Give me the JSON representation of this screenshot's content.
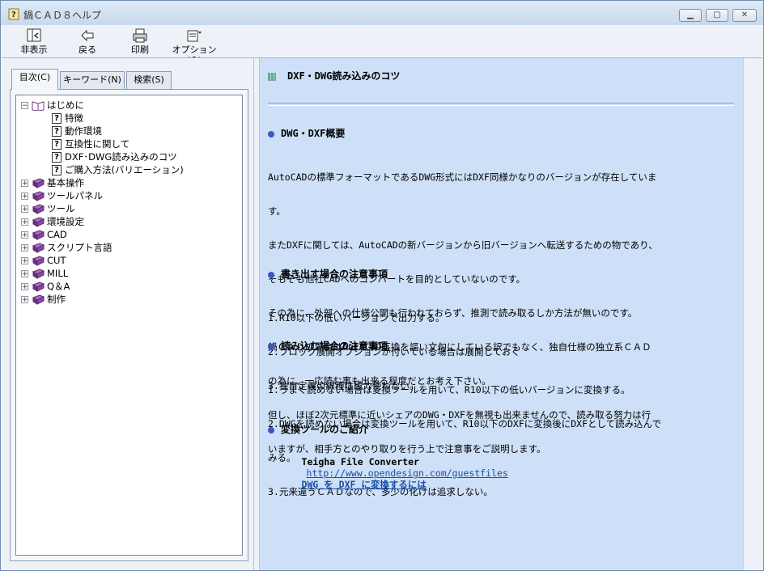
{
  "window": {
    "title": "鍋ＣＡＤ８ヘルプ"
  },
  "toolbar": {
    "hide": "非表示",
    "back": "戻る",
    "print": "印刷",
    "options": "オプション(O)"
  },
  "tabs": [
    "目次(C)",
    "キーワード(N)",
    "検索(S)"
  ],
  "tree": {
    "root": "はじめに",
    "children": [
      "特徴",
      "動作環境",
      "互換性に関して",
      "DXF･DWG読み込みのコツ",
      "ご購入方法(バリエーション)"
    ],
    "books": [
      "基本操作",
      "ツールパネル",
      "ツール",
      "環境設定",
      "CAD",
      "スクリプト言語",
      "CUT",
      "MILL",
      "Q＆A",
      "制作"
    ]
  },
  "doc": {
    "title": "DXF・DWG読み込みのコツ",
    "s1": {
      "heading": "DWG・DXF概要",
      "lines": [
        "AutoCADの標準フォーマットであるDWG形式にはDXF同様かなりのバージョンが存在していま",
        "す。",
        "またDXFに関しては、AutoCADの新バージョンから旧バージョンへ転送するための物であり、",
        "そもそも他社CADへのコンバートを目的としていないのです。",
        "その為に、外部への仕様公開も行われておらず、推測で読み取るしか方法が無いのです。",
        "鍋ＣＡＤの場合はAutoCAD互換を謳い文句にしている訳でもなく、独自仕様の独立系ＣＡＤ",
        "の為に、一応読む事も出来る程度だとお考え下さい。",
        "但し、ほぼ2次元標準に近いシェアのDWG・DXFを無視も出来ませんので、読み取る努力は行",
        "いますが、相手方とのやり取りを行う上で注意事をご説明します。"
      ]
    },
    "s2": {
      "heading": "書き出す場合の注意事項",
      "lines": [
        "1.R10以下の低いバージョンで出力する。",
        "2.ブロック展開オプションが付いている場合は展開しておく",
        "3.独自定義の線種は極力使わない。"
      ]
    },
    "s3": {
      "heading": "読み込む場合の注意事項",
      "lines": [
        "1.うまく読めない場合は変換ツールを用いて、R10以下の低いバージョンに変換する。",
        "2.DWGを読めない場合は変換ツールを用いて、R10以下のDXFに変換後にDXFとして読み込んで",
        "みる。",
        "3.元来違うＣＡＤなので、多少の化けは追求しない。"
      ]
    },
    "s4": {
      "heading": "変換ツールのご紹介",
      "tool_name": "Teigha File Converter",
      "tool_url": "http://www.opendesign.com/guestfiles",
      "howto_link": "DWG を DXF に変換するには"
    }
  }
}
